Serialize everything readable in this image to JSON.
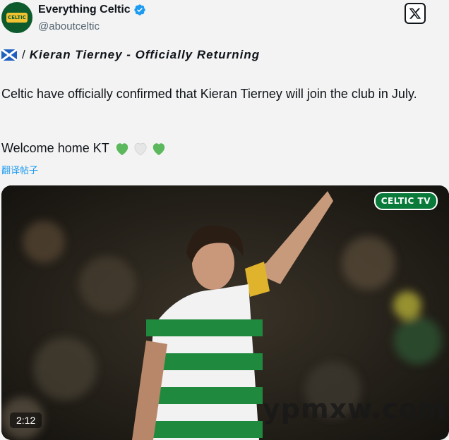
{
  "author": {
    "display_name": "Everything Celtic",
    "handle": "@aboutceltic",
    "avatar_text": "CELTIC",
    "verified": true,
    "avatar_icon": "celtic-crest-avatar"
  },
  "platform_icon": "x-logo-icon",
  "post": {
    "flag": "scotland-flag",
    "separator": "/",
    "headline": "Kieran Tierney - Officially Returning",
    "body": "Celtic have officially confirmed that Kieran Tierney will join the club in July.",
    "welcome": "Welcome home KT",
    "hearts": [
      "green",
      "white",
      "green"
    ],
    "translate_label": "翻译帖子"
  },
  "media": {
    "channel_logo": "CELTIC TV",
    "duration": "2:12",
    "watermark": "ypmxw.com"
  },
  "colors": {
    "celtic_green": "#3fae49",
    "link_blue": "#1d9bf0",
    "verified_blue": "#1d9bf0"
  }
}
